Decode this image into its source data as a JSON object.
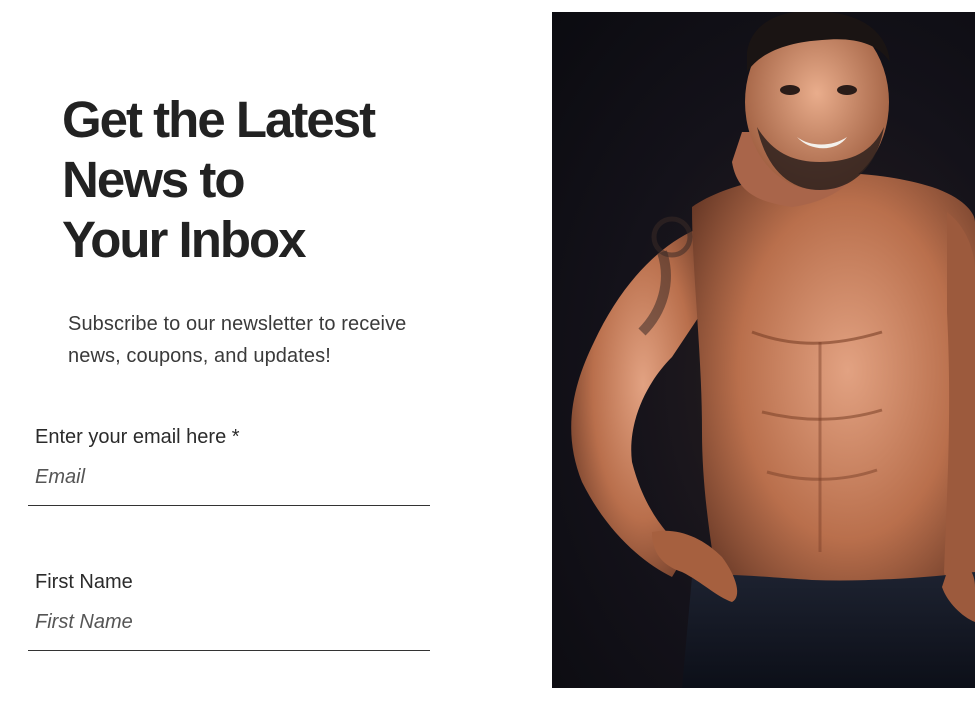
{
  "headline": {
    "line1": "Get the Latest",
    "line2": "News to",
    "line3": "Your Inbox"
  },
  "subtext": {
    "line1": "Subscribe to our newsletter to receive",
    "line2": "news, coupons, and updates!"
  },
  "form": {
    "email": {
      "label": "Enter your email here *",
      "placeholder": "Email"
    },
    "first_name": {
      "label": "First Name",
      "placeholder": "First Name"
    }
  },
  "photo": {
    "icon": "fitness-model-photo"
  },
  "colors": {
    "text": "#222222",
    "input_underline": "#333333",
    "photo_background": "#0b0b10"
  }
}
